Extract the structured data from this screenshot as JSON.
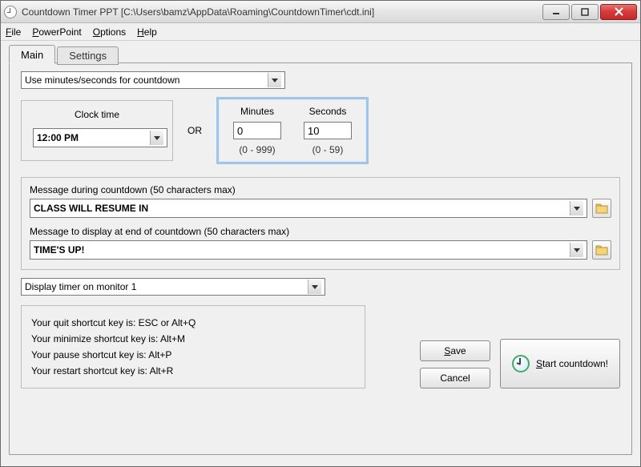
{
  "window": {
    "title": "Countdown Timer PPT  [C:\\Users\\bamz\\AppData\\Roaming\\CountdownTimer\\cdt.ini]"
  },
  "menu": {
    "file": "File",
    "powerpoint": "PowerPoint",
    "options": "Options",
    "help": "Help"
  },
  "tabs": {
    "main": "Main",
    "settings": "Settings"
  },
  "mode_select": "Use minutes/seconds for countdown",
  "clock": {
    "label": "Clock time",
    "value": "12:00 PM"
  },
  "or_label": "OR",
  "minutes": {
    "label": "Minutes",
    "value": "0",
    "range": "(0 - 999)"
  },
  "seconds": {
    "label": "Seconds",
    "value": "10",
    "range": "(0 - 59)"
  },
  "msg_during": {
    "label": "Message during countdown (50 characters max)",
    "value": "CLASS WILL RESUME IN"
  },
  "msg_end": {
    "label": "Message to display at end of countdown (50 characters max)",
    "value": "TIME'S UP!"
  },
  "monitor_select": "Display timer on monitor 1",
  "shortcuts": {
    "quit": "Your quit shortcut key is: ESC or Alt+Q",
    "minimize": "Your minimize shortcut key is: Alt+M",
    "pause": "Your pause shortcut key is: Alt+P",
    "restart": "Your restart shortcut key is: Alt+R"
  },
  "buttons": {
    "save": "Save",
    "cancel": "Cancel",
    "start": "Start countdown!"
  }
}
